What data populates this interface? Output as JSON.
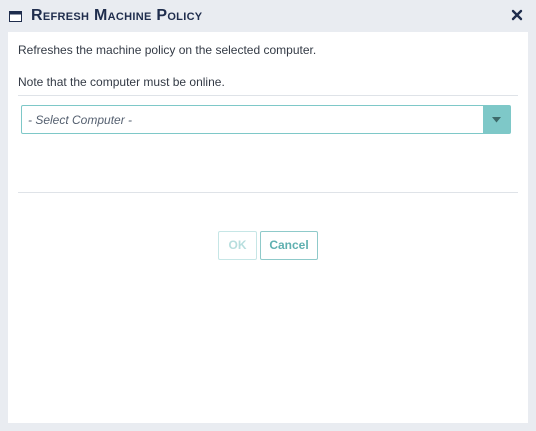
{
  "dialog": {
    "title": "Refresh Machine Policy",
    "description": "Refreshes the machine policy on the selected computer.",
    "note": "Note that the computer must be online.",
    "computer_select": {
      "value": "- Select Computer -"
    },
    "buttons": {
      "ok": "OK",
      "cancel": "Cancel"
    },
    "icons": {
      "window": "window-icon",
      "close": "close-icon",
      "dropdown": "chevron-down-icon"
    },
    "colors": {
      "title": "#1f2d4d",
      "accent": "#7ec8c8",
      "background": "#e9ecf1"
    }
  }
}
